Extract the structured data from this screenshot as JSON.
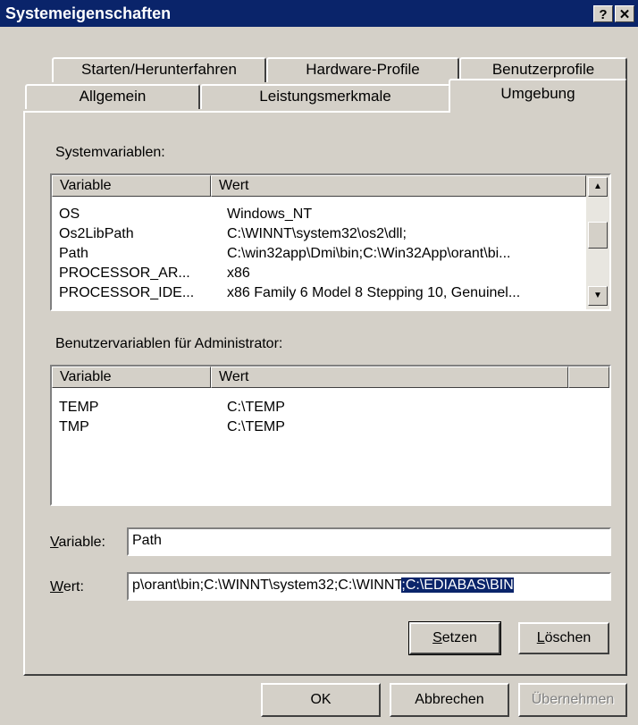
{
  "window": {
    "title": "Systemeigenschaften",
    "help_glyph": "?",
    "close_glyph": "✕"
  },
  "tabs_row1": [
    "Starten/Herunterfahren",
    "Hardware-Profile",
    "Benutzerprofile"
  ],
  "tabs_row2": [
    "Allgemein",
    "Leistungsmerkmale",
    "Umgebung"
  ],
  "active_tab": "Umgebung",
  "system_vars": {
    "label": "Systemvariablen:",
    "columns": [
      "Variable",
      "Wert"
    ],
    "rows": [
      [
        "OS",
        "Windows_NT"
      ],
      [
        "Os2LibPath",
        "C:\\WINNT\\system32\\os2\\dll;"
      ],
      [
        "Path",
        "C:\\win32app\\Dmi\\bin;C:\\Win32App\\orant\\bi..."
      ],
      [
        "PROCESSOR_AR...",
        "x86"
      ],
      [
        "PROCESSOR_IDE...",
        "x86 Family 6 Model 8 Stepping 10, Genuinel..."
      ]
    ]
  },
  "user_vars": {
    "label": "Benutzervariablen für Administrator:",
    "columns": [
      "Variable",
      "Wert"
    ],
    "rows": [
      [
        "TEMP",
        "C:\\TEMP"
      ],
      [
        "TMP",
        "C:\\TEMP"
      ]
    ]
  },
  "variable_field": {
    "label": "Variable:",
    "value": "Path"
  },
  "wert_field": {
    "label": "Wert:",
    "value_plain": "p\\orant\\bin;C:\\WINNT\\system32;C:\\WINNT",
    "value_selected": ";C:\\EDIABAS\\BIN"
  },
  "buttons": {
    "setzen": "Setzen",
    "loeschen": "Löschen",
    "ok": "OK",
    "abbrechen": "Abbrechen",
    "uebernehmen": "Übernehmen"
  },
  "icons": {
    "scroll_up": "▲",
    "scroll_down": "▼"
  }
}
